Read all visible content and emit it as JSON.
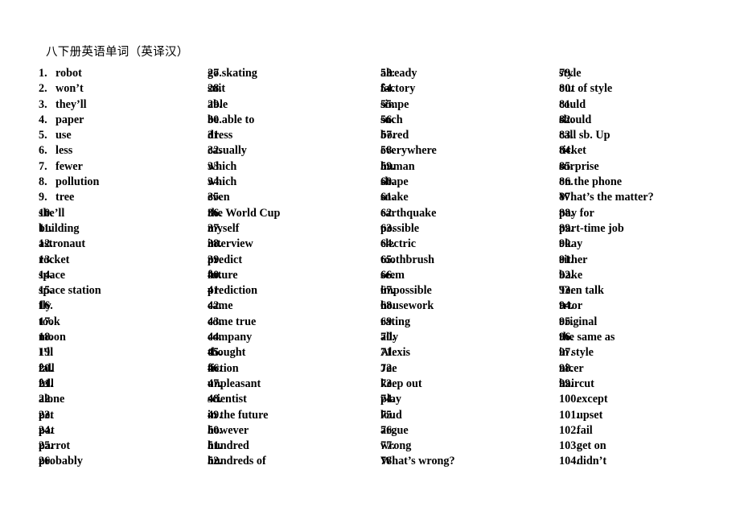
{
  "document": {
    "title": "八下册英语单词（英译汉）",
    "background_color": "#ffffff",
    "text_color": "#000000"
  },
  "columns": [
    {
      "id": "column-1",
      "items": [
        {
          "number": "1.",
          "term": "robot"
        },
        {
          "number": "2.",
          "term": "won’t"
        },
        {
          "number": "3.",
          "term": "they’ll"
        },
        {
          "number": "4.",
          "term": "paper"
        },
        {
          "number": "5.",
          "term": "use"
        },
        {
          "number": "6.",
          "term": "less"
        },
        {
          "number": "7.",
          "term": "fewer"
        },
        {
          "number": "8.",
          "term": "pollution"
        },
        {
          "number": "9.",
          "term": "tree"
        },
        {
          "number": "10.",
          "term": "she’ll"
        },
        {
          "number": "11.",
          "term": "building"
        },
        {
          "number": "12.",
          "term": "astronaut"
        },
        {
          "number": "13.",
          "term": "rocket"
        },
        {
          "number": "14.",
          "term": "space"
        },
        {
          "number": "15.",
          "term": "space station"
        },
        {
          "number": "16.",
          "term": "fly"
        },
        {
          "number": "17.",
          "term": "took"
        },
        {
          "number": "18.",
          "term": "moon"
        },
        {
          "number": "19.",
          "term": "I’ll"
        },
        {
          "number": "20.",
          "term": "fall"
        },
        {
          "number": "21.",
          "term": "fell"
        },
        {
          "number": "22.",
          "term": "alone"
        },
        {
          "number": "23.",
          "term": "pet"
        },
        {
          "number": "24.",
          "term": "pat"
        },
        {
          "number": "25.",
          "term": "parrot"
        },
        {
          "number": "26.",
          "term": "probably"
        }
      ]
    },
    {
      "id": "column-2",
      "items": [
        {
          "number": "27.",
          "term": "go skating"
        },
        {
          "number": "28.",
          "term": "suit"
        },
        {
          "number": "29.",
          "term": "able"
        },
        {
          "number": "30.",
          "term": "be able to"
        },
        {
          "number": "31.",
          "term": "dress"
        },
        {
          "number": "32.",
          "term": "casually"
        },
        {
          "number": "33.",
          "term": "which"
        },
        {
          "number": "34.",
          "term": "which"
        },
        {
          "number": "35.",
          "term": "even"
        },
        {
          "number": "36.",
          "term": "the World Cup"
        },
        {
          "number": "37.",
          "term": "myself"
        },
        {
          "number": "38.",
          "term": "interview"
        },
        {
          "number": "39.",
          "term": "predict"
        },
        {
          "number": "40.",
          "term": "future"
        },
        {
          "number": "41.",
          "term": "prediction"
        },
        {
          "number": "42.",
          "term": "came"
        },
        {
          "number": "43.",
          "term": "come true"
        },
        {
          "number": "44.",
          "term": "company"
        },
        {
          "number": "45.",
          "term": "thought"
        },
        {
          "number": "46.",
          "term": "fiction"
        },
        {
          "number": "47.",
          "term": "unpleasant"
        },
        {
          "number": "48.",
          "term": "scientist"
        },
        {
          "number": "49.",
          "term": "in the future"
        },
        {
          "number": "50.",
          "term": "however"
        },
        {
          "number": "51.",
          "term": "hundred"
        },
        {
          "number": "52.",
          "term": "hundreds of"
        }
      ]
    },
    {
      "id": "column-3",
      "items": [
        {
          "number": "53.",
          "term": "already"
        },
        {
          "number": "54.",
          "term": "factory"
        },
        {
          "number": "55.",
          "term": "simpe"
        },
        {
          "number": "56.",
          "term": "such"
        },
        {
          "number": "57.",
          "term": "bored"
        },
        {
          "number": "58.",
          "term": "everywhere"
        },
        {
          "number": "59.",
          "term": "human"
        },
        {
          "number": "60.",
          "term": "shape"
        },
        {
          "number": "61.",
          "term": "snake"
        },
        {
          "number": "62.",
          "term": "earthquake"
        },
        {
          "number": "63.",
          "term": "possible"
        },
        {
          "number": "64.",
          "term": "electric"
        },
        {
          "number": "65.",
          "term": "toothbrush"
        },
        {
          "number": "66.",
          "term": "seem"
        },
        {
          "number": "67.",
          "term": "impossible"
        },
        {
          "number": "68.",
          "term": "housework"
        },
        {
          "number": "69.",
          "term": "rating"
        },
        {
          "number": "70.",
          "term": "ally"
        },
        {
          "number": "71.",
          "term": "Alexis"
        },
        {
          "number": "72.",
          "term": "Joe"
        },
        {
          "number": "73.",
          "term": "keep out"
        },
        {
          "number": "74.",
          "term": "play"
        },
        {
          "number": "75.",
          "term": "loud"
        },
        {
          "number": "76.",
          "term": "argue"
        },
        {
          "number": "77.",
          "term": "wrong"
        },
        {
          "number": "78.",
          "term": "What’s wrong?"
        }
      ]
    },
    {
      "id": "column-4",
      "items": [
        {
          "number": "79.",
          "term": "style"
        },
        {
          "number": "80.",
          "term": "out of style"
        },
        {
          "number": "81.",
          "term": "could"
        },
        {
          "number": "82.",
          "term": "should"
        },
        {
          "number": "83.",
          "term": "call sb. Up"
        },
        {
          "number": "84.",
          "term": "ticket"
        },
        {
          "number": "85.",
          "term": "surprise"
        },
        {
          "number": "86.",
          "term": "on the phone"
        },
        {
          "number": "87.",
          "term": "What’s the matter?"
        },
        {
          "number": "88.",
          "term": "pay for"
        },
        {
          "number": "89.",
          "term": "part-time job"
        },
        {
          "number": "90.",
          "term": "okay"
        },
        {
          "number": "91.",
          "term": "either"
        },
        {
          "number": "92.",
          "term": "bake"
        },
        {
          "number": "93.",
          "term": "Teen talk"
        },
        {
          "number": "94.",
          "term": "trtor"
        },
        {
          "number": "95.",
          "term": "original"
        },
        {
          "number": "96.",
          "term": "the same as"
        },
        {
          "number": "97.",
          "term": "in style"
        },
        {
          "number": "98.",
          "term": "nicer"
        },
        {
          "number": "99.",
          "term": "haircut"
        },
        {
          "number": "100.",
          "term": "except"
        },
        {
          "number": "101.",
          "term": "upset"
        },
        {
          "number": "102.",
          "term": "fail"
        },
        {
          "number": "103.",
          "term": "get on"
        },
        {
          "number": "104.",
          "term": "didn’t"
        }
      ]
    }
  ]
}
